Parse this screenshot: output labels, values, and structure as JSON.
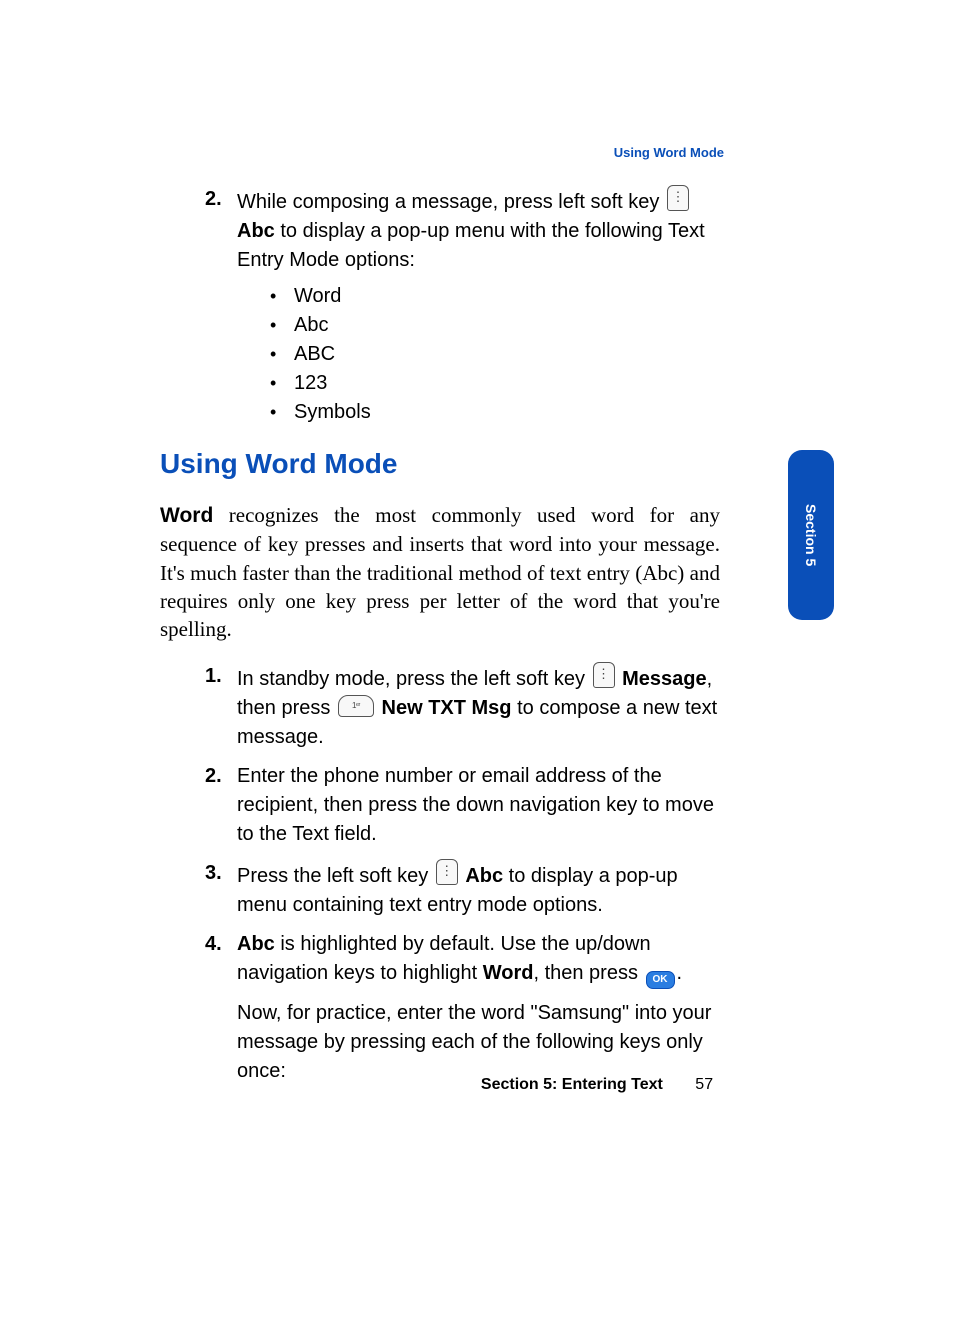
{
  "header": {
    "running_head": "Using Word Mode"
  },
  "step2": {
    "num": "2.",
    "text_before_icon": "While composing a message, press left soft key ",
    "bold_after_icon": "Abc",
    "text_after_bold": " to display a pop-up menu with the following Text Entry Mode options:"
  },
  "bullets": [
    "Word",
    "Abc",
    "ABC",
    "123",
    "Symbols"
  ],
  "h2": "Using Word Mode",
  "intro": {
    "bold_lead": "Word",
    "rest": " recognizes the most commonly used word for any sequence of key presses and inserts that word into your message. It's much faster than the traditional method of text entry (Abc) and requires only one key press per letter of the word that you're spelling."
  },
  "steps": {
    "s1": {
      "num": "1.",
      "a": "In standby mode, press the left soft key ",
      "b1": "Message",
      "c": ", then press ",
      "b2": "New TXT Msg",
      "d": " to compose a new text message."
    },
    "s2": {
      "num": "2.",
      "text": "Enter the phone number or email address of the recipient, then press the down navigation key to move to the Text field."
    },
    "s3": {
      "num": "3.",
      "a": "Press the left soft key ",
      "b1": "Abc",
      "c": " to display a pop-up menu containing text entry mode options."
    },
    "s4": {
      "num": "4.",
      "b1": "Abc",
      "a": " is highlighted by default. Use the up/down navigation keys to highlight ",
      "b2": "Word",
      "c": ", then press ",
      "d": ".",
      "para2": "Now, for practice, enter the word \"Samsung\" into your message by pressing each of the following keys only once:"
    }
  },
  "side_tab": "Section 5",
  "footer": {
    "section": "Section 5: Entering Text",
    "page": "57"
  },
  "ok_label": "OK"
}
